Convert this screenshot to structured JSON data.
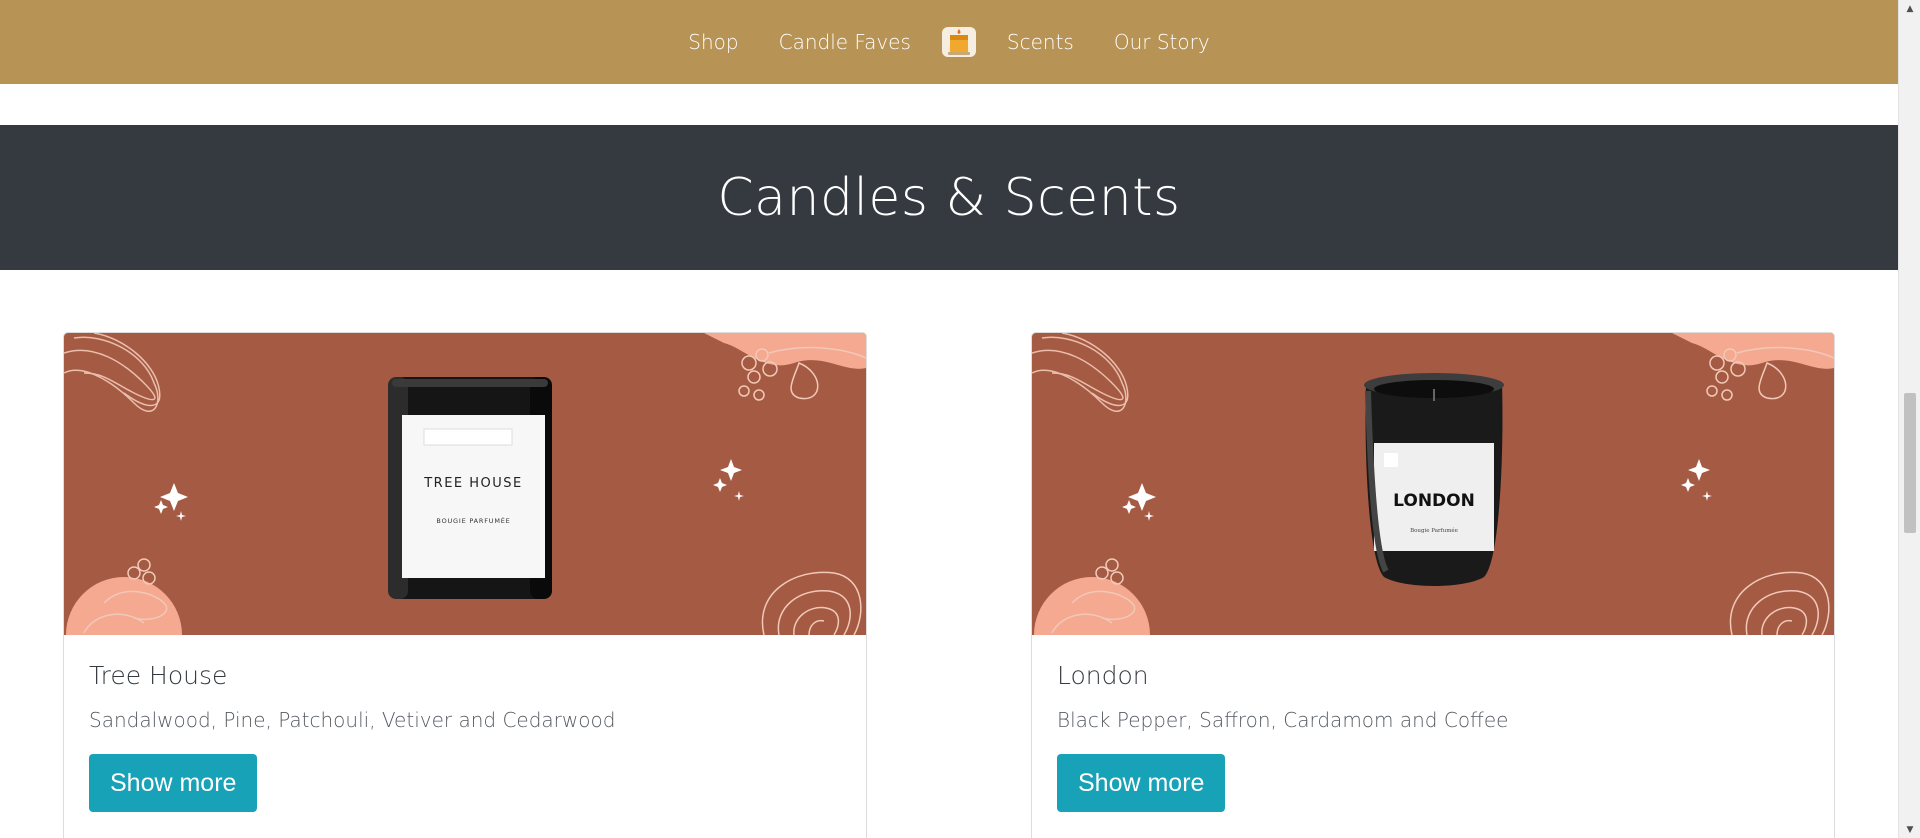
{
  "nav": {
    "links": [
      "Shop",
      "Candle Faves",
      "Scents",
      "Our Story"
    ],
    "logo_icon": "candle-logo-icon",
    "background": "#b89356"
  },
  "hero": {
    "title": "Candles & Scents",
    "background": "#343a40"
  },
  "products": [
    {
      "name": "Tree House",
      "notes": "Sandalwood, Pine, Patchouli, Vetiver and Cedarwood",
      "button_label": "Show more",
      "jar_label": "TREE HOUSE",
      "jar_sublabel": "BOUGIE PARFUMÉE"
    },
    {
      "name": "London",
      "notes": "Black Pepper, Saffron, Cardamom and Coffee",
      "button_label": "Show more",
      "jar_label": "LONDON",
      "jar_sublabel": "Bougie Parfumée"
    }
  ],
  "colors": {
    "accent": "#17a2b8",
    "card_image_bg": "#a55a43",
    "deco_peach": "#f4a990"
  }
}
